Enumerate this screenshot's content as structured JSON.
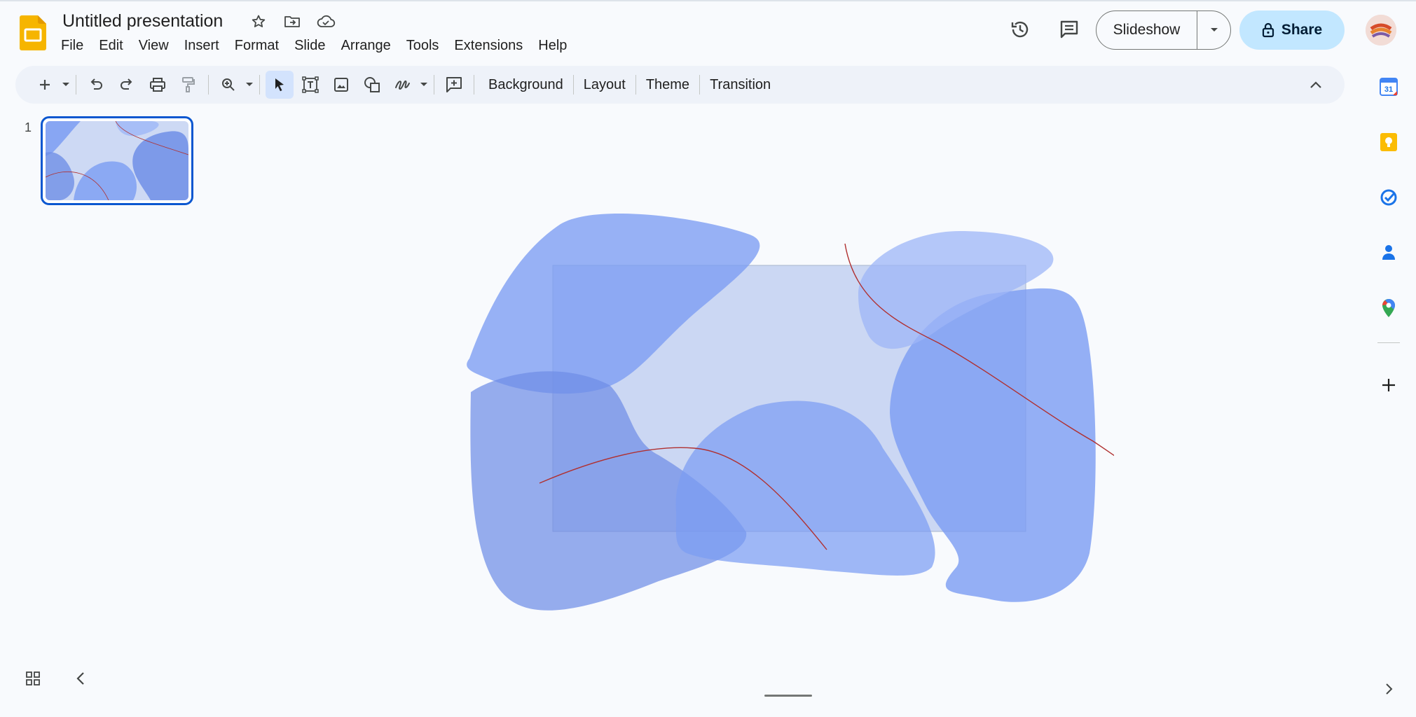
{
  "document": {
    "title": "Untitled presentation"
  },
  "menu": [
    "File",
    "Edit",
    "View",
    "Insert",
    "Format",
    "Slide",
    "Arrange",
    "Tools",
    "Extensions",
    "Help"
  ],
  "header": {
    "slideshow_label": "Slideshow",
    "share_label": "Share"
  },
  "toolbar": {
    "background_label": "Background",
    "layout_label": "Layout",
    "theme_label": "Theme",
    "transition_label": "Transition"
  },
  "filmstrip": {
    "slide_number": "1"
  },
  "side_panel": {
    "calendar_date": "31"
  },
  "colors": {
    "accent": "#0b57d0",
    "share_bg": "#c2e7ff",
    "toolbar_bg": "#eef2f9",
    "shape_blue": "#7b9cf2",
    "line_red": "#b03030"
  },
  "icons": {
    "star": "star-icon",
    "move": "folder-move-icon",
    "cloud": "cloud-saved-icon",
    "history": "history-icon",
    "comments": "comment-icon",
    "lock": "lock-icon"
  }
}
